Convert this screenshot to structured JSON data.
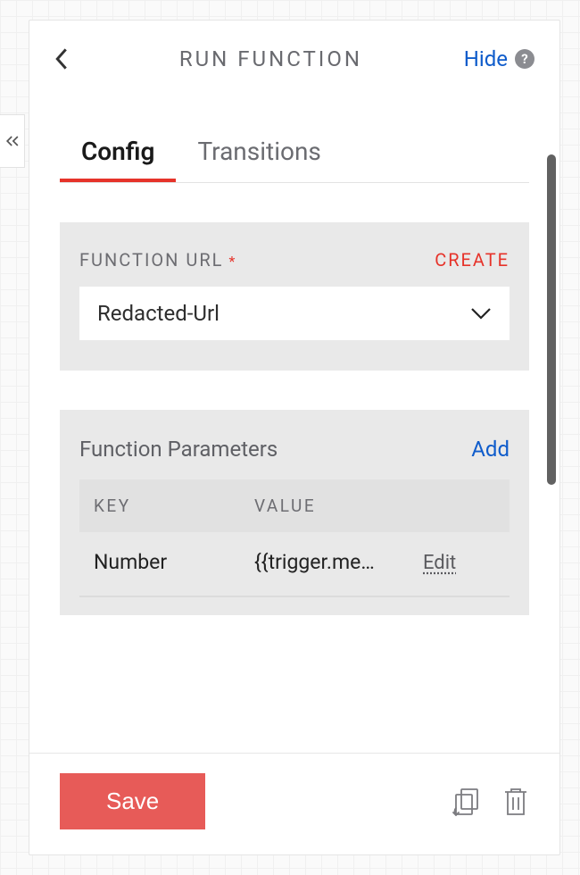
{
  "header": {
    "title": "RUN FUNCTION",
    "hide": "Hide"
  },
  "tabs": {
    "config": "Config",
    "transitions": "Transitions"
  },
  "functionUrl": {
    "label": "FUNCTION URL",
    "create": "CREATE",
    "value": "Redacted-Url"
  },
  "params": {
    "title": "Function Parameters",
    "add": "Add",
    "headers": {
      "key": "KEY",
      "value": "VALUE"
    },
    "rows": [
      {
        "key": "Number",
        "value": "{{trigger.me…"
      }
    ],
    "edit": "Edit"
  },
  "footer": {
    "save": "Save"
  }
}
